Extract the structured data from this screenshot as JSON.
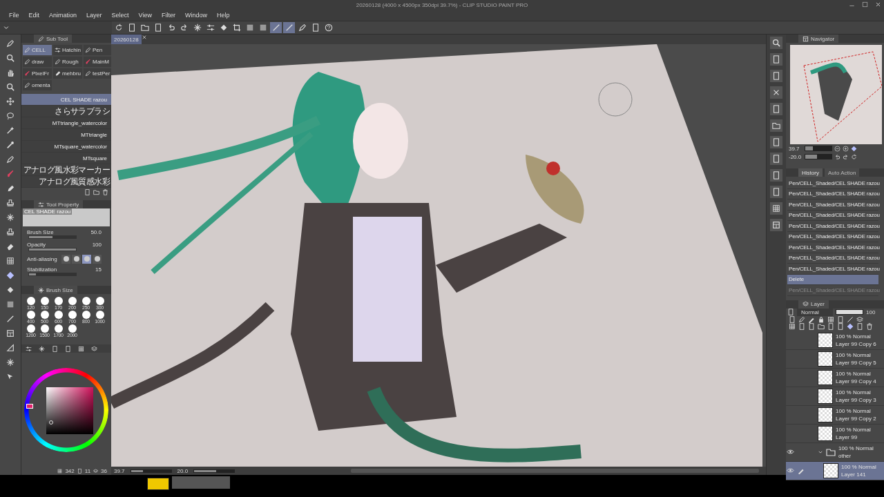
{
  "window": {
    "title": "20260128 (4000 x 4500px 350dpi 39.7%) - CLIP STUDIO PAINT PRO"
  },
  "menu": [
    "File",
    "Edit",
    "Animation",
    "Layer",
    "Select",
    "View",
    "Filter",
    "Window",
    "Help"
  ],
  "command_bar": {
    "buttons": [
      {
        "selected": false
      },
      {
        "selected": false
      },
      {
        "selected": false
      },
      {
        "selected": false
      },
      {
        "selected": false
      },
      {
        "selected": false
      },
      {
        "selected": false
      },
      {
        "selected": false
      },
      {
        "selected": false
      },
      {
        "selected": false
      },
      {
        "selected": false
      },
      {
        "selected": false
      },
      {
        "selected": true
      },
      {
        "selected": true
      },
      {
        "selected": false
      },
      {
        "selected": false
      },
      {
        "selected": false
      }
    ]
  },
  "sub_tool": {
    "title": "Sub Tool",
    "groups": [
      {
        "label": "CELL",
        "selected": true
      },
      {
        "label": "Hatchin",
        "selected": false
      },
      {
        "label": "Pen",
        "selected": false
      },
      {
        "label": "draw",
        "selected": false
      },
      {
        "label": "Rough",
        "selected": false
      },
      {
        "label": "MainM",
        "selected": false
      },
      {
        "label": "PixelFr",
        "selected": false
      },
      {
        "label": "mehbru",
        "selected": false
      },
      {
        "label": "testPer",
        "selected": false
      },
      {
        "label": "omenta",
        "selected": false
      }
    ],
    "brushes": [
      {
        "label": "CEL SHADE razou",
        "selected": true
      },
      {
        "label": "さらサラブラシ",
        "selected": false
      },
      {
        "label": "MTtriangle_watercolor",
        "selected": false
      },
      {
        "label": "MTtriangle",
        "selected": false
      },
      {
        "label": "MTsquare_watercolor",
        "selected": false
      },
      {
        "label": "MTsquare",
        "selected": false
      },
      {
        "label": "アナログ風水彩マーカー",
        "selected": false
      },
      {
        "label": "アナログ風質感水彩",
        "selected": false
      }
    ]
  },
  "tool_property": {
    "title": "Tool Property",
    "preview": "CEL SHADE razou",
    "settings": [
      {
        "kind": "slider",
        "label": "Brush Size",
        "value": "50.0",
        "level": 0.5
      },
      {
        "kind": "slider",
        "label": "Opacity",
        "value": "100",
        "level": 1
      },
      {
        "kind": "options",
        "label": "Anti-aliasing",
        "options": [
          {
            "selected": false
          },
          {
            "selected": false
          },
          {
            "selected": true
          },
          {
            "selected": false
          }
        ]
      },
      {
        "kind": "slider",
        "label": "Stabilization",
        "value": "15",
        "level": 0.15
      }
    ]
  },
  "brush_size": {
    "title": "Brush Size",
    "sizes": [
      "120",
      "150",
      "170",
      "200",
      "250",
      "300",
      "400",
      "500",
      "600",
      "700",
      "800",
      "1000",
      "1200",
      "1500",
      "1700",
      "2000"
    ]
  },
  "color": {
    "counts": [
      "342",
      "11",
      "36"
    ]
  },
  "canvas": {
    "tab": "20260128",
    "zoom": {
      "reading": "39.7",
      "level": 0.3
    },
    "angle": {
      "reading": "20.0",
      "level": 0.55
    }
  },
  "navigator": {
    "title": "Navigator",
    "zoom": {
      "reading": "39.7",
      "level": 0.3
    },
    "angle": {
      "reading": "-20.0",
      "level": 0.45
    }
  },
  "history": {
    "tabs": [
      {
        "label": "History",
        "selected": true
      },
      {
        "label": "Auto Action",
        "selected": false
      }
    ],
    "entries": [
      {
        "label": "Pen/CELL_Shaded/CEL SHADE razou",
        "selected": false,
        "disabled": false
      },
      {
        "label": "Pen/CELL_Shaded/CEL SHADE razou",
        "selected": false,
        "disabled": false
      },
      {
        "label": "Pen/CELL_Shaded/CEL SHADE razou",
        "selected": false,
        "disabled": false
      },
      {
        "label": "Pen/CELL_Shaded/CEL SHADE razou",
        "selected": false,
        "disabled": false
      },
      {
        "label": "Pen/CELL_Shaded/CEL SHADE razou",
        "selected": false,
        "disabled": false
      },
      {
        "label": "Pen/CELL_Shaded/CEL SHADE razou",
        "selected": false,
        "disabled": false
      },
      {
        "label": "Pen/CELL_Shaded/CEL SHADE razou",
        "selected": false,
        "disabled": false
      },
      {
        "label": "Pen/CELL_Shaded/CEL SHADE razou",
        "selected": false,
        "disabled": false
      },
      {
        "label": "Pen/CELL_Shaded/CEL SHADE razou",
        "selected": false,
        "disabled": false
      },
      {
        "label": "Delete",
        "selected": true,
        "disabled": false
      },
      {
        "label": "Pen/CELL_Shaded/CEL SHADE razou",
        "selected": false,
        "disabled": true
      }
    ]
  },
  "layer": {
    "title": "Layer",
    "blend_mode": "Normal",
    "opacity": {
      "reading": "100",
      "level": 1
    },
    "layers": [
      {
        "kind": "layer",
        "mode": "100 % Normal",
        "name": "Layer 99 Copy 6",
        "visible": false,
        "selected": false,
        "editing": false
      },
      {
        "kind": "layer",
        "mode": "100 % Normal",
        "name": "Layer 99 Copy 5",
        "visible": false,
        "selected": false,
        "editing": false
      },
      {
        "kind": "layer",
        "mode": "100 % Normal",
        "name": "Layer 99 Copy 4",
        "visible": false,
        "selected": false,
        "editing": false
      },
      {
        "kind": "layer",
        "mode": "100 % Normal",
        "name": "Layer 99 Copy 3",
        "visible": false,
        "selected": false,
        "editing": false
      },
      {
        "kind": "layer",
        "mode": "100 % Normal",
        "name": "Layer 99 Copy 2",
        "visible": false,
        "selected": false,
        "editing": false
      },
      {
        "kind": "layer",
        "mode": "100 % Normal",
        "name": "Layer 99",
        "visible": false,
        "selected": false,
        "editing": false
      },
      {
        "kind": "folder",
        "mode": "100 % Normal",
        "name": "other",
        "visible": true,
        "selected": false,
        "editing": false,
        "expanded": true,
        "children": [
          {
            "kind": "layer",
            "mode": "100 % Normal",
            "name": "Layer 141",
            "visible": true,
            "selected": true,
            "editing": true
          }
        ]
      }
    ]
  }
}
